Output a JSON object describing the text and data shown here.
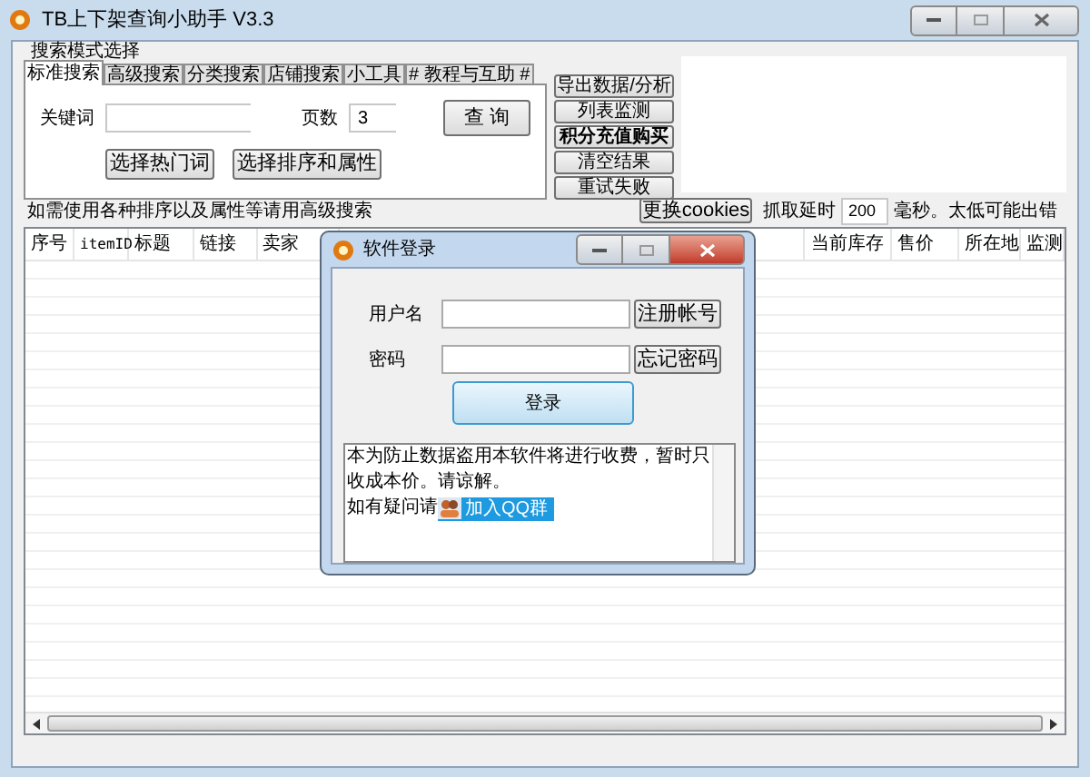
{
  "window": {
    "title": "TB上下架查询小助手 V3.3"
  },
  "search_group": {
    "title": "搜索模式选择",
    "tabs": [
      {
        "label": "标准搜索",
        "selected": true
      },
      {
        "label": "高级搜索",
        "selected": false
      },
      {
        "label": "分类搜索",
        "selected": false
      },
      {
        "label": "店铺搜索",
        "selected": false
      },
      {
        "label": "小工具",
        "selected": false
      },
      {
        "label": "# 教程与互助 #",
        "selected": false
      }
    ],
    "keyword": {
      "label": "关键词"
    },
    "pages": {
      "label": "页数",
      "value": "3"
    },
    "query_button": "查 询",
    "hot_words_button": "选择热门词",
    "sort_button": "选择排序和属性"
  },
  "side_buttons": [
    {
      "label": "导出数据/分析",
      "bold": false
    },
    {
      "label": "列表监测",
      "bold": false
    },
    {
      "label": "积分充值购买",
      "bold": true
    },
    {
      "label": "清空结果",
      "bold": false
    },
    {
      "label": "重试失败",
      "bold": false
    }
  ],
  "hint": "如需使用各种排序以及属性等请用高级搜索",
  "cookies_button": "更换cookies",
  "delay": {
    "label": "抓取延时",
    "value": "200",
    "unit": "毫秒。太低可能出错"
  },
  "table": {
    "columns": [
      {
        "label": "序号"
      },
      {
        "label": "itemID"
      },
      {
        "label": "标题"
      },
      {
        "label": "链接"
      },
      {
        "label": "卖家"
      },
      {
        "label": "当前库存"
      },
      {
        "label": "售价"
      },
      {
        "label": "所在地"
      },
      {
        "label": "监测"
      }
    ]
  },
  "dialog": {
    "title": "软件登录",
    "username_label": "用户名",
    "register_button": "注册帐号",
    "password_label": "密码",
    "forgot_button": "忘记密码",
    "login_button": "登录",
    "notice": "本为防止数据盗用本软件将进行收费，暂时只收成本价。请谅解。",
    "notice_tail": "如有疑问请",
    "qq_button": "加入QQ群"
  }
}
